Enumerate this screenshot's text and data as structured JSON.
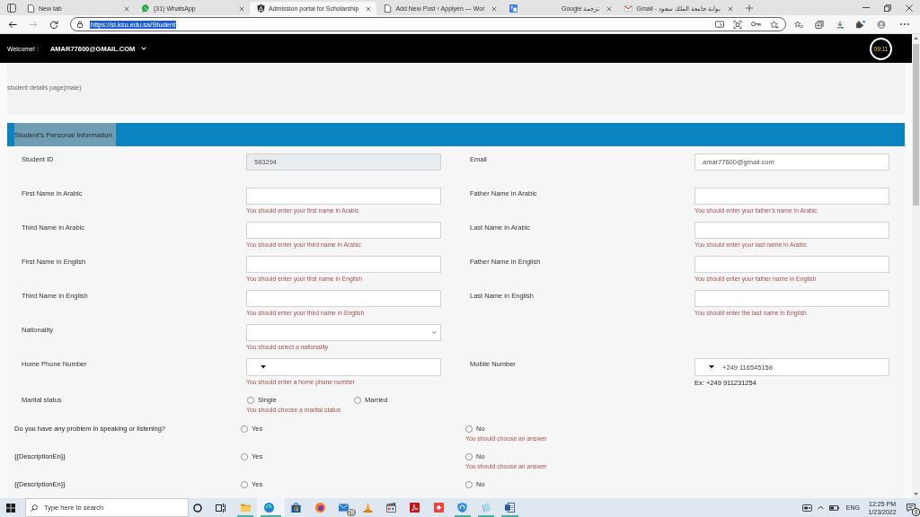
{
  "browser": {
    "tabs": [
      {
        "title": "New tab",
        "kind": "page",
        "selected": false
      },
      {
        "title": "(31) WhatsApp",
        "kind": "chat",
        "selected": false
      },
      {
        "title": "Admission portal for Scholarship",
        "kind": "shield",
        "selected": true
      },
      {
        "title": "Add New Post ‹ Applyen — Wor",
        "kind": "page",
        "selected": false
      },
      {
        "title": "ترجمة Google",
        "kind": "translate",
        "selected": false
      },
      {
        "title": "Gmail - بوابة جامعة الملك سعود",
        "kind": "mail",
        "selected": false
      }
    ],
    "nav": [
      {
        "kind": "back",
        "disabled": false
      },
      {
        "kind": "forward",
        "disabled": true
      },
      {
        "kind": "reload",
        "disabled": false
      }
    ],
    "address": {
      "url": "https://si.ksu.edu.sa/Student",
      "highlighted": true
    }
  },
  "header": {
    "greeting": "Welcome! :",
    "user": "AMAR77600@GMAIL.COM",
    "timer": "09:11"
  },
  "page": {
    "subtitle": "student details page(male)",
    "section_title": "Student's Personal Information"
  },
  "form": {
    "rows": [
      {
        "fields": [
          {
            "label": "Student ID",
            "kind": "text",
            "value": "583294",
            "disabled": true
          },
          {
            "label": "Email",
            "kind": "text",
            "value": "amar77600@gmail.com",
            "disabled": false
          }
        ]
      },
      {
        "fields": [
          {
            "label": "First Name in Arabic",
            "kind": "text",
            "disabled": false,
            "error": "You should enter your first name in Arabic"
          },
          {
            "label": "Father Name in Arabic",
            "kind": "text",
            "disabled": false,
            "error": "You should enter your father's name in Arabic"
          }
        ]
      },
      {
        "fields": [
          {
            "label": "Third Name in Arabic",
            "kind": "text",
            "disabled": false,
            "error": "You should enter your third name in Arabic"
          },
          {
            "label": "Last Name in Arabic",
            "kind": "text",
            "disabled": false,
            "error": "You should enter your last name in Arabic"
          }
        ]
      },
      {
        "fields": [
          {
            "label": "First Name in English",
            "kind": "text",
            "disabled": false,
            "error": "You should enter your first name in English"
          },
          {
            "label": "Father Name in English",
            "kind": "text",
            "disabled": false,
            "error": "You should enter your father name in English"
          }
        ]
      },
      {
        "fields": [
          {
            "label": "Third Name in English",
            "kind": "text",
            "disabled": false,
            "error": "You should enter your third name in English"
          },
          {
            "label": "Last Name in English",
            "kind": "text",
            "disabled": false,
            "error": "You should enter the last name in English"
          }
        ]
      },
      {
        "fields": [
          {
            "label": "Nationality",
            "kind": "select",
            "disabled": false,
            "error": "You should select a nationality"
          }
        ]
      },
      {
        "fields": [
          {
            "label": "Home Phone Number",
            "kind": "phone",
            "disabled": false,
            "error": "You should enter a home phone number"
          },
          {
            "label": "Mobile Number",
            "kind": "phone",
            "disabled": false,
            "value": "+249 116545158",
            "hint": "Ex: +249 911231254"
          }
        ]
      }
    ],
    "marital": {
      "label": "Marital status",
      "options": [
        {
          "label": "Single",
          "selected": false
        },
        {
          "label": "Married",
          "selected": false
        }
      ],
      "error": "You should choose a marital status"
    },
    "questions": [
      {
        "label": "Do you have any problem in speaking or listening?",
        "options": [
          {
            "label": "Yes",
            "selected": false
          },
          {
            "label": "No",
            "selected": false
          }
        ],
        "error": "You should choose an answer"
      },
      {
        "label": "{{DescriptionEn}}",
        "options": [
          {
            "label": "Yes",
            "selected": false
          },
          {
            "label": "No",
            "selected": false
          }
        ],
        "error": "You should choose an answer"
      },
      {
        "label": "{{DescriptionEn}}",
        "options": [
          {
            "label": "Yes",
            "selected": false
          },
          {
            "label": "No",
            "selected": false
          }
        ]
      }
    ]
  },
  "taskbar": {
    "search_placeholder": "Type here to search",
    "apps": [
      {
        "kind": "folder",
        "open": true,
        "selected": false
      },
      {
        "kind": "swirl",
        "open": true,
        "selected": true
      },
      {
        "kind": "bag",
        "open": false,
        "selected": false
      },
      {
        "kind": "globe",
        "open": false,
        "selected": false
      },
      {
        "kind": "mail",
        "open": false,
        "selected": false,
        "badge": "28"
      },
      {
        "kind": "cone",
        "open": false,
        "selected": false
      },
      {
        "kind": "clapper",
        "open": false,
        "selected": false
      },
      {
        "kind": "pdf",
        "open": false,
        "selected": false
      },
      {
        "kind": "diamond",
        "open": false,
        "selected": false
      },
      {
        "kind": "shield",
        "open": true,
        "selected": false
      },
      {
        "kind": "paper",
        "open": true,
        "selected": false
      },
      {
        "kind": "doc",
        "open": true,
        "selected": false
      }
    ],
    "language": "ENG",
    "time": "12:25 PM",
    "date": "1/23/2022",
    "notifications": "8"
  }
}
